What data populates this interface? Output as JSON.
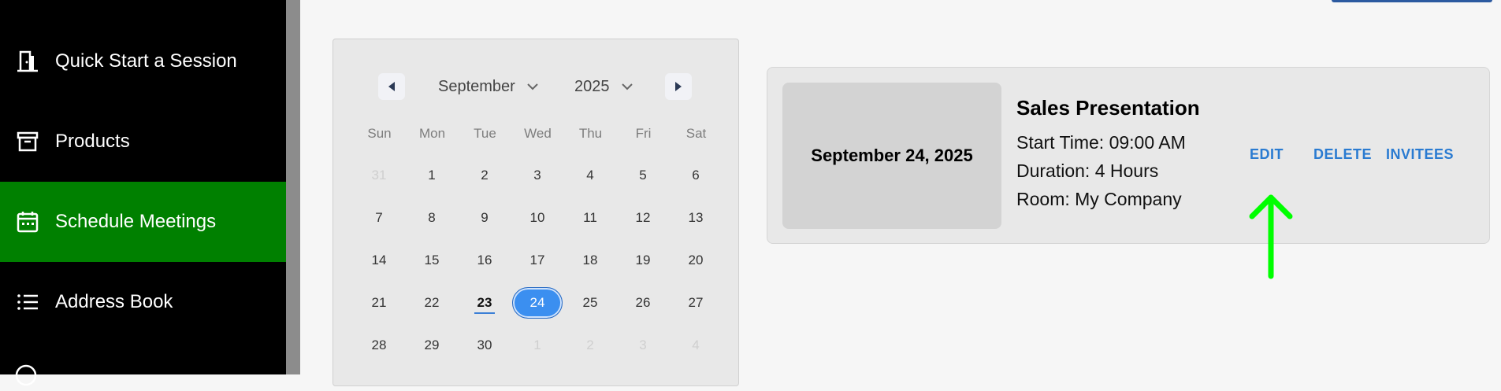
{
  "sidebar": {
    "items": [
      {
        "label": "Quick Start a Session",
        "icon": "door-icon"
      },
      {
        "label": "Products",
        "icon": "archive-box-icon"
      },
      {
        "label": "Schedule Meetings",
        "icon": "calendar-icon",
        "active": true
      },
      {
        "label": "Address Book",
        "icon": "list-icon"
      }
    ],
    "active_color": "#008000"
  },
  "calendar": {
    "month": "September",
    "year": "2025",
    "weekdays": [
      "Sun",
      "Mon",
      "Tue",
      "Wed",
      "Thu",
      "Fri",
      "Sat"
    ],
    "weeks": [
      [
        "31",
        "1",
        "2",
        "3",
        "4",
        "5",
        "6"
      ],
      [
        "7",
        "8",
        "9",
        "10",
        "11",
        "12",
        "13"
      ],
      [
        "14",
        "15",
        "16",
        "17",
        "18",
        "19",
        "20"
      ],
      [
        "21",
        "22",
        "23",
        "24",
        "25",
        "26",
        "27"
      ],
      [
        "28",
        "29",
        "30",
        "1",
        "2",
        "3",
        "4"
      ]
    ],
    "today": "23",
    "selected": "24"
  },
  "event": {
    "date": "September 24, 2025",
    "title": "Sales Presentation",
    "start_time": "Start Time: 09:00 AM",
    "duration": "Duration: 4 Hours",
    "room": "Room: My Company",
    "actions": {
      "edit": "EDIT",
      "delete": "DELETE",
      "invitees": "INVITEES"
    }
  },
  "colors": {
    "accent": "#2a7bd1",
    "selected_day": "#3b8ff0",
    "annotation_arrow": "#00ff00"
  }
}
